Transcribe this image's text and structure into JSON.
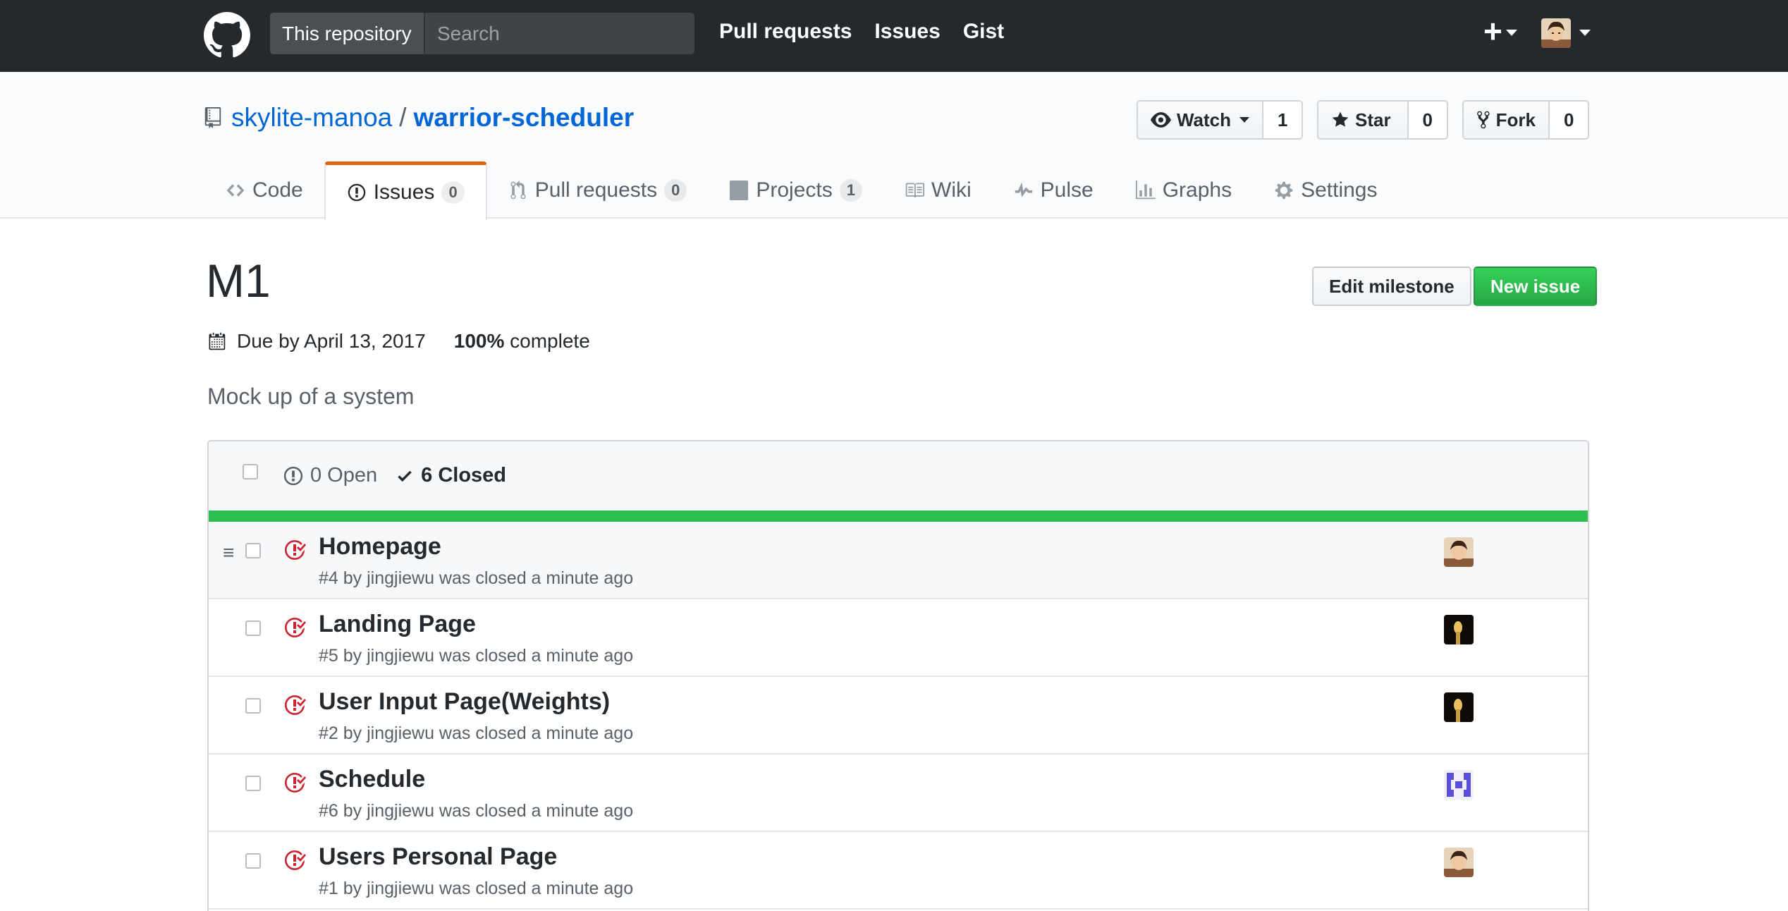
{
  "header": {
    "scope_label": "This repository",
    "search_placeholder": "Search",
    "nav": [
      "Pull requests",
      "Issues",
      "Gist"
    ],
    "new_menu_label": "+"
  },
  "repo": {
    "owner": "skylite-manoa",
    "separator": "/",
    "name": "warrior-scheduler",
    "watch": {
      "label": "Watch",
      "count": "1"
    },
    "star": {
      "label": "Star",
      "count": "0"
    },
    "fork": {
      "label": "Fork",
      "count": "0"
    },
    "tabs": [
      {
        "label": "Code",
        "icon": "code-icon"
      },
      {
        "label": "Issues",
        "count": "0",
        "icon": "issue-opened-icon"
      },
      {
        "label": "Pull requests",
        "count": "0",
        "icon": "git-pull-request-icon"
      },
      {
        "label": "Projects",
        "count": "1",
        "icon": "project-icon"
      },
      {
        "label": "Wiki",
        "icon": "book-icon"
      },
      {
        "label": "Pulse",
        "icon": "pulse-icon"
      },
      {
        "label": "Graphs",
        "icon": "graph-icon"
      },
      {
        "label": "Settings",
        "icon": "gear-icon"
      }
    ],
    "selected_tab": "Issues"
  },
  "milestone": {
    "title": "M1",
    "edit_button": "Edit milestone",
    "new_issue_button": "New issue",
    "due": "Due by April 13, 2017",
    "percent": "100%",
    "complete_label": "complete",
    "description": "Mock up of a system",
    "progress_fraction": 1.0
  },
  "issues_box": {
    "open_label": "0 Open",
    "closed_label": "6 Closed",
    "issues": [
      {
        "title": "Homepage",
        "meta": "#4 by jingjiewu was closed a minute ago",
        "avatar": "person"
      },
      {
        "title": "Landing Page",
        "meta": "#5 by jingjiewu was closed a minute ago",
        "avatar": "dark"
      },
      {
        "title": "User Input Page(Weights)",
        "meta": "#2 by jingjiewu was closed a minute ago",
        "avatar": "dark"
      },
      {
        "title": "Schedule",
        "meta": "#6 by jingjiewu was closed a minute ago",
        "avatar": "identicon"
      },
      {
        "title": "Users Personal Page",
        "meta": "#1 by jingjiewu was closed a minute ago",
        "avatar": "person"
      }
    ]
  },
  "colors": {
    "header_bg": "#24292e",
    "link": "#0366d6",
    "closed_icon": "#cb2431",
    "progress": "#2cbe4e",
    "primary_button": "#28a745",
    "tab_accent": "#e36209"
  }
}
